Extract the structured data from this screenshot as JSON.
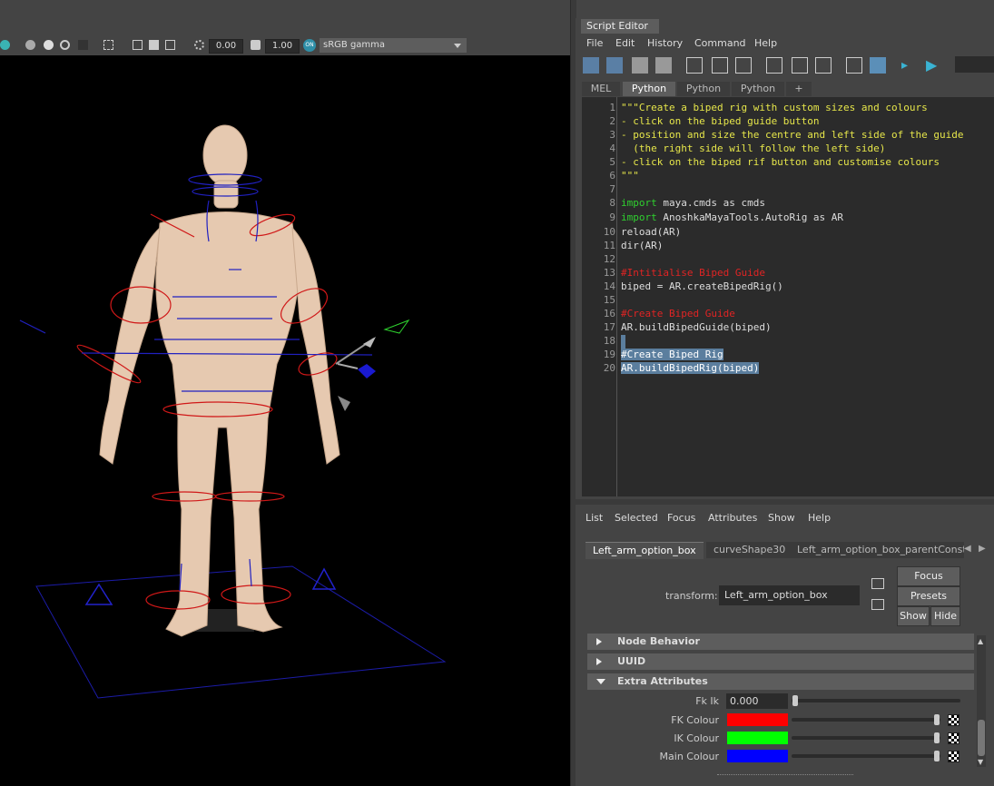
{
  "viewport": {
    "toolbar": {
      "exposure": "0.00",
      "gamma": "1.00",
      "colorspace_toggle": "ON",
      "colorspace": "sRGB gamma"
    }
  },
  "script_editor": {
    "title": "Script Editor",
    "menu": [
      "File",
      "Edit",
      "History",
      "Command",
      "Help"
    ],
    "tabs": [
      "MEL",
      "Python",
      "Python",
      "Python",
      "+"
    ],
    "active_tab_index": 1,
    "line_numbers": [
      "1",
      "2",
      "3",
      "4",
      "5",
      "6",
      "7",
      "8",
      "9",
      "10",
      "11",
      "12",
      "13",
      "14",
      "15",
      "16",
      "17",
      "18",
      "19",
      "20"
    ],
    "code": {
      "l1": "\"\"\"Create a biped rig with custom sizes and colours",
      "l2": "- click on the biped guide button",
      "l3": "- position and size the centre and left side of the guide",
      "l4": "  (the right side will follow the left side)",
      "l5": "- click on the biped rif button and customise colours",
      "l6": "\"\"\"",
      "l8_kw": "import",
      "l8_rest": " maya.cmds as cmds",
      "l9_kw": "import",
      "l9_rest": " AnoshkaMayaTools.AutoRig as AR",
      "l10": "reload(AR)",
      "l11": "dir(AR)",
      "l13": "#Intitialise Biped Guide",
      "l14": "biped = AR.createBipedRig()",
      "l16": "#Create Biped Guide",
      "l17": "AR.buildBipedGuide(biped)",
      "l19": "#Create Biped Rig",
      "l20": "AR.buildBipedRig(biped)"
    }
  },
  "attribute_editor": {
    "menu": [
      "List",
      "Selected",
      "Focus",
      "Attributes",
      "Show",
      "Help"
    ],
    "tabs": [
      "Left_arm_option_box",
      "curveShape30",
      "Left_arm_option_box_parentConstr"
    ],
    "transform_label": "transform:",
    "transform_value": "Left_arm_option_box",
    "buttons": {
      "focus": "Focus",
      "presets": "Presets",
      "show": "Show",
      "hide": "Hide"
    },
    "sections": [
      "Node Behavior",
      "UUID",
      "Extra Attributes"
    ],
    "attributes": {
      "fk_ik_label": "Fk Ik",
      "fk_ik_value": "0.000",
      "fk_colour_label": "FK Colour",
      "ik_colour_label": "IK Colour",
      "main_colour_label": "Main Colour"
    },
    "colors": {
      "fk": "#ff0000",
      "ik": "#00ff00",
      "main": "#0000ff"
    }
  }
}
